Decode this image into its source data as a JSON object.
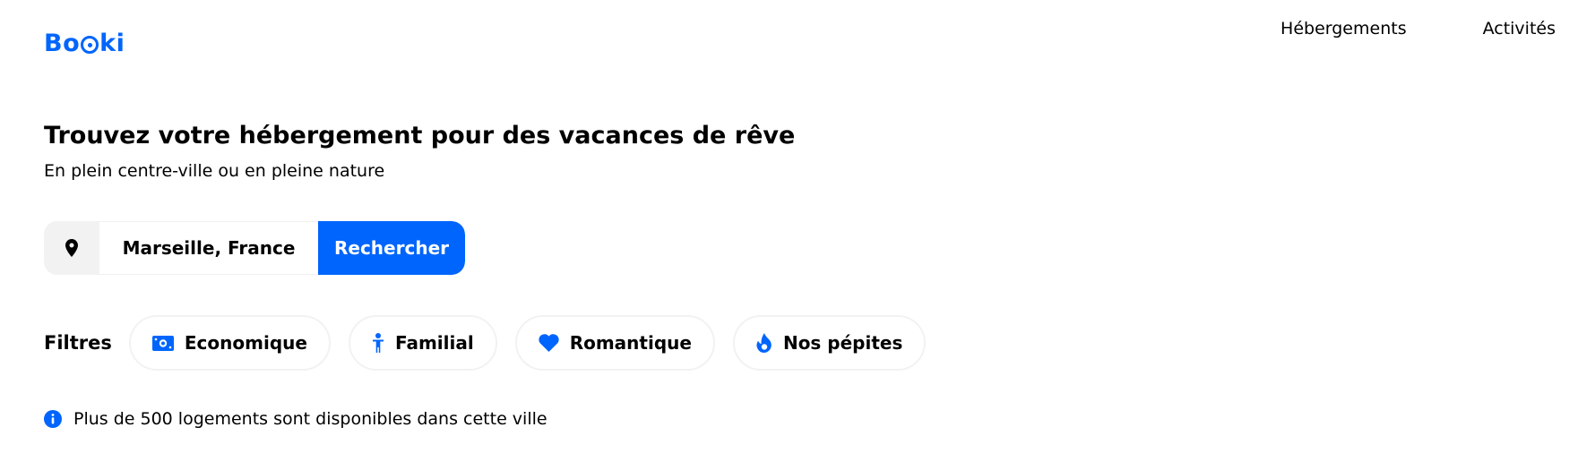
{
  "brand": {
    "logo_text_before": "Bo",
    "logo_text_after": "ki",
    "accent_color": "#0065fc"
  },
  "nav": {
    "items": [
      {
        "label": "Hébergements"
      },
      {
        "label": "Activités"
      }
    ]
  },
  "hero": {
    "title": "Trouvez votre hébergement pour des vacances de rêve",
    "subtitle": "En plein centre-ville ou en pleine nature"
  },
  "search": {
    "icon": "map-pin-icon",
    "value": "Marseille, France",
    "button_label": "Rechercher"
  },
  "filters": {
    "label": "Filtres",
    "items": [
      {
        "label": "Economique",
        "icon": "money-icon"
      },
      {
        "label": "Familial",
        "icon": "person-icon"
      },
      {
        "label": "Romantique",
        "icon": "heart-icon"
      },
      {
        "label": "Nos pépites",
        "icon": "fire-icon"
      }
    ]
  },
  "info": {
    "icon": "info-icon",
    "text": "Plus de 500 logements sont disponibles dans cette ville"
  }
}
